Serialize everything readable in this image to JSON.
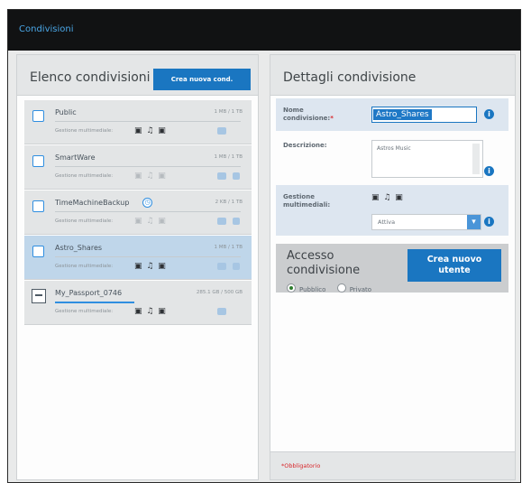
{
  "topbar": {
    "title": "Condivisioni"
  },
  "left": {
    "title": "Elenco condivisioni",
    "new_button": "Crea nuova cond.",
    "shares": [
      {
        "name": "Public",
        "size": "1 MB / 1 TB",
        "media_label": "Gestione multimediale:",
        "media_icons": "▣ ♫ ▣",
        "selected": false,
        "drive": false
      },
      {
        "name": "SmartWare",
        "size": "1 MB / 1 TB",
        "media_label": "Gestione multimediale:",
        "media_icons": "▣ ♫ ▣",
        "selected": false,
        "drive": false
      },
      {
        "name": "TimeMachineBackup",
        "size": "2 KB / 1 TB",
        "media_label": "Gestione multimediale:",
        "media_icons": "▣ ♫ ▣",
        "selected": false,
        "drive": false
      },
      {
        "name": "Astro_Shares",
        "size": "1 MB / 1 TB",
        "media_label": "Gestione multimediale:",
        "media_icons": "▣ ♫ ▣",
        "selected": true,
        "drive": false
      },
      {
        "name": "My_Passport_0746",
        "size": "285.1 GB / 500 GB",
        "media_label": "Gestione multimediale:",
        "media_icons": "▣ ♫ ▣",
        "selected": false,
        "drive": true
      }
    ]
  },
  "right": {
    "title": "Dettagli condivisione",
    "name_label": "Nome condivisione:",
    "name_required_mark": "*",
    "name_value": "Astro_Shares",
    "desc_label": "Descrizione:",
    "desc_value": "Astros Music",
    "media_label": "Gestione multimediali:",
    "media_icons": "▣ ♫ ▣",
    "media_select": "Attiva",
    "access_title_1": "Accesso",
    "access_title_2": "condivisione",
    "create_user_1": "Crea nuovo",
    "create_user_2": "utente",
    "radio_public": "Pubblico",
    "radio_private": "Privato",
    "footer": "*Obbligatorio"
  },
  "colors": {
    "accent": "#1a76c1",
    "topbar": "#111213",
    "selected_row": "#bfd6ea"
  }
}
